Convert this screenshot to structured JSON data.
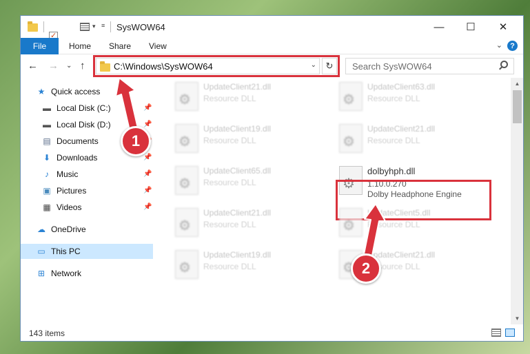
{
  "window": {
    "title": "SysWOW64",
    "minimize_glyph": "—",
    "maximize_glyph": "☐",
    "close_glyph": "✕"
  },
  "ribbon": {
    "tabs": [
      "File",
      "Home",
      "Share",
      "View"
    ],
    "help_glyph": "?",
    "expand_glyph": "⌄"
  },
  "nav": {
    "back_glyph": "←",
    "forward_glyph": "→",
    "recent_glyph": "⌄",
    "up_glyph": "↑",
    "address": "C:\\Windows\\SysWOW64",
    "address_dropdown_glyph": "⌄",
    "refresh_glyph": "↻",
    "search_placeholder": "Search SysWOW64"
  },
  "sidebar": {
    "items": [
      {
        "label": "Quick access",
        "icon": "star-icon",
        "glyph": "★",
        "pinned": false
      },
      {
        "label": "Local Disk (C:)",
        "icon": "drive-icon",
        "glyph": "▬",
        "pinned": true
      },
      {
        "label": "Local Disk (D:)",
        "icon": "drive-icon",
        "glyph": "▬",
        "pinned": true
      },
      {
        "label": "Documents",
        "icon": "documents-icon",
        "glyph": "▤",
        "pinned": true
      },
      {
        "label": "Downloads",
        "icon": "download-icon",
        "glyph": "⬇",
        "pinned": true
      },
      {
        "label": "Music",
        "icon": "music-icon",
        "glyph": "♪",
        "pinned": true
      },
      {
        "label": "Pictures",
        "icon": "pictures-icon",
        "glyph": "▣",
        "pinned": true
      },
      {
        "label": "Videos",
        "icon": "videos-icon",
        "glyph": "▦",
        "pinned": true
      },
      {
        "label": "OneDrive",
        "icon": "cloud-icon",
        "glyph": "☁",
        "pinned": false
      },
      {
        "label": "This PC",
        "icon": "computer-icon",
        "glyph": "▭",
        "pinned": false
      },
      {
        "label": "Network",
        "icon": "network-icon",
        "glyph": "⊞",
        "pinned": false
      }
    ],
    "pin_glyph": "📌"
  },
  "files": [
    {
      "name": "UpdateClient21.dll",
      "desc": "Resource DLL"
    },
    {
      "name": "UpdateClient63.dll",
      "desc": "Resource DLL"
    },
    {
      "name": "UpdateClient19.dll",
      "desc": "Resource DLL"
    },
    {
      "name": "UpdateClient21.dll",
      "desc": "Resource DLL"
    },
    {
      "name": "UpdateClient65.dll",
      "desc": "Resource DLL"
    },
    {
      "name": "dolbyhph.dll",
      "version": "1.10.0.270",
      "desc": "Dolby Headphone Engine"
    },
    {
      "name": "UpdateClient21.dll",
      "desc": "Resource DLL"
    },
    {
      "name": "UpdateClient5.dll",
      "desc": "Resource DLL"
    },
    {
      "name": "UpdateClient19.dll",
      "desc": "Resource DLL"
    },
    {
      "name": "UpdateClient21.dll",
      "desc": "Resource DLL"
    }
  ],
  "status": {
    "item_count": "143 items"
  },
  "annotations": {
    "step1": "1",
    "step2": "2",
    "color": "#d9323c"
  }
}
